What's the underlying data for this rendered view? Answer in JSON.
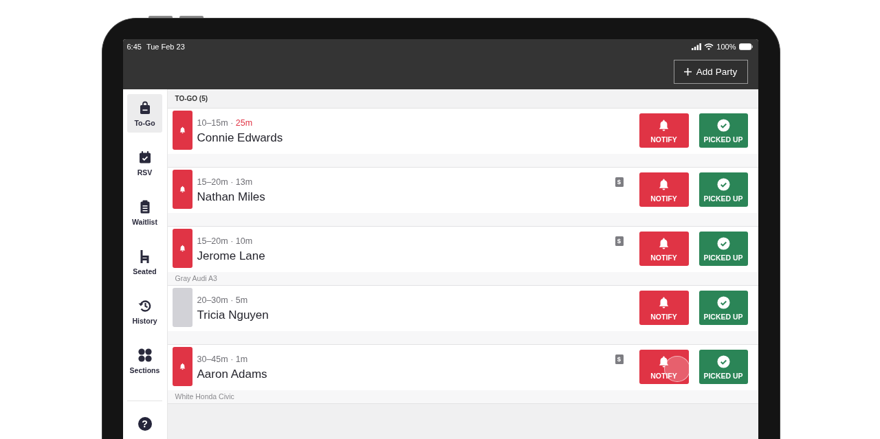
{
  "status_bar": {
    "time": "6:45",
    "date": "Tue Feb 23",
    "battery": "100%"
  },
  "toolbar": {
    "add_button": "Add Party"
  },
  "sidebar": {
    "items": [
      {
        "label": "To-Go",
        "selected": true
      },
      {
        "label": "RSV",
        "selected": false
      },
      {
        "label": "Waitlist",
        "selected": false
      },
      {
        "label": "Seated",
        "selected": false
      },
      {
        "label": "History",
        "selected": false
      },
      {
        "label": "Sections",
        "selected": false
      }
    ],
    "help": "?"
  },
  "list": {
    "title": "TO-GO (5)",
    "rows": [
      {
        "alert": true,
        "quote": "10–15m ·",
        "elapsed": "25m",
        "late": true,
        "name": "Connie Edwards",
        "notify": "NOTIFY",
        "picked_up": "PICKED UP",
        "touched": false
      },
      {
        "alert": true,
        "quote": "15–20m ·",
        "elapsed": "13m",
        "late": false,
        "name": "Nathan Miles",
        "paid_mark": "$",
        "notify": "NOTIFY",
        "picked_up": "PICKED UP",
        "touched": false
      },
      {
        "alert": true,
        "quote": "15–20m ·",
        "elapsed": "10m",
        "late": false,
        "name": "Jerome Lane",
        "paid_mark": "$",
        "note": "Gray Audi A3",
        "notify": "NOTIFY",
        "picked_up": "PICKED UP",
        "touched": false
      },
      {
        "alert": false,
        "quote": "20–30m ·",
        "elapsed": "5m",
        "late": false,
        "name": "Tricia Nguyen",
        "notify": "NOTIFY",
        "picked_up": "PICKED UP",
        "touched": false
      },
      {
        "alert": true,
        "quote": "30–45m ·",
        "elapsed": "1m",
        "late": false,
        "name": "Aaron Adams",
        "paid_mark": "$",
        "note": "White Honda Civic",
        "notify": "NOTIFY",
        "picked_up": "PICKED UP",
        "touched": true
      }
    ]
  }
}
